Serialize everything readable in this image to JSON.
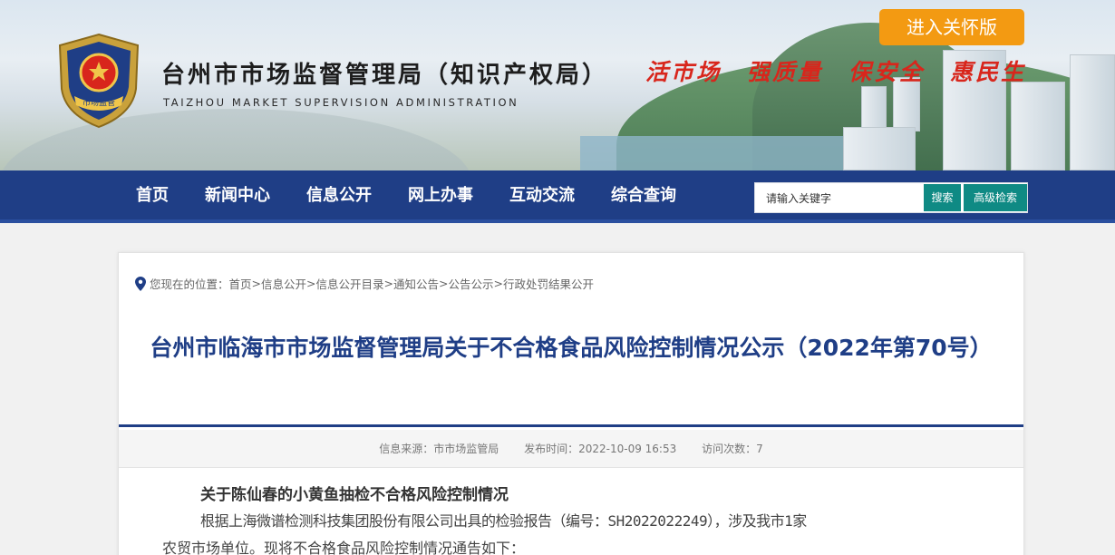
{
  "header": {
    "site_title": "台州市市场监督管理局（知识产权局）",
    "site_subtitle": "TAIZHOU MARKET SUPERVISION ADMINISTRATION",
    "slogan": "活市场　强质量　保安全　惠民生",
    "care_button": "进入关怀版",
    "emblem_text": "市场监管"
  },
  "nav": {
    "items": [
      "首页",
      "新闻中心",
      "信息公开",
      "网上办事",
      "互动交流",
      "综合查询"
    ]
  },
  "search": {
    "placeholder": "请输入关键字",
    "value": "请输入关键字",
    "search_label": "搜索",
    "advanced_label": "高级检索"
  },
  "breadcrumb": {
    "prefix": "您现在的位置：",
    "items": [
      "首页",
      "信息公开",
      "信息公开目录",
      "通知公告",
      "公告公示",
      "行政处罚结果公开"
    ]
  },
  "article": {
    "title": "台州市临海市市场监督管理局关于不合格食品风险控制情况公示（2022年第70号）",
    "source": "信息来源：市市场监管局",
    "publish_time": "发布时间：2022-10-09 16:53",
    "views": "访问次数：7",
    "heading": "关于陈仙春的小黄鱼抽检不合格风险控制情况",
    "paragraph_1": "根据上海微谱检测科技集团股份有限公司出具的检验报告（编号：SH2022022249），涉及我市1家",
    "paragraph_2": "农贸市场单位。现将不合格食品风险控制情况通告如下："
  },
  "colors": {
    "nav_bg": "#1f3e86",
    "care_button": "#f39a12",
    "search_button": "#0f8a84",
    "slogan": "#d8261c",
    "title": "#1f3e86"
  },
  "icons": [
    "national-emblem-icon",
    "location-pin-icon"
  ]
}
